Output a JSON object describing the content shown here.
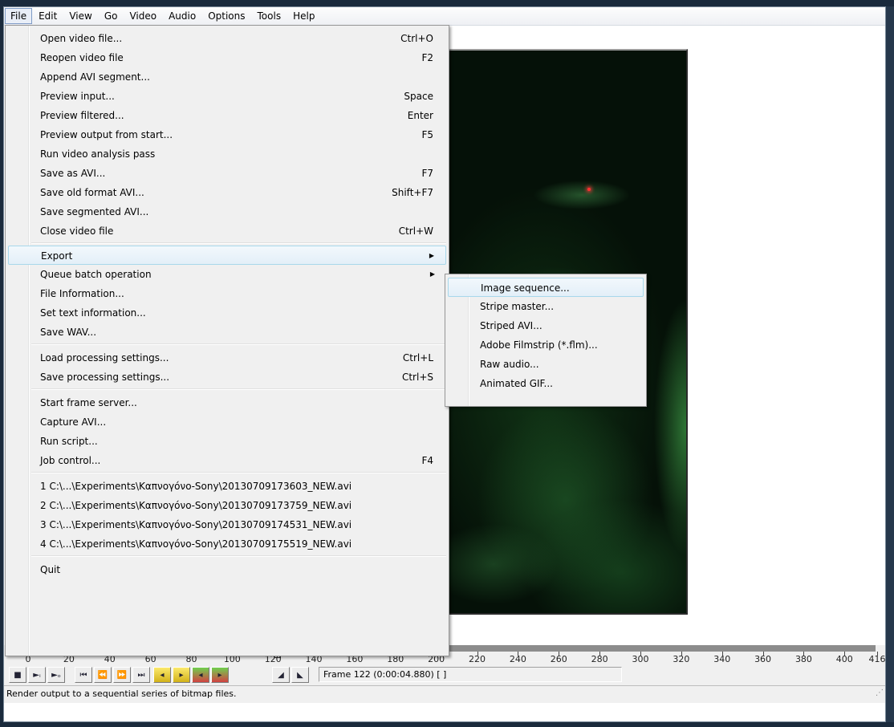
{
  "menubar": [
    "File",
    "Edit",
    "View",
    "Go",
    "Video",
    "Audio",
    "Options",
    "Tools",
    "Help"
  ],
  "file_menu": [
    {
      "label": "Open video file...",
      "shortcut": "Ctrl+O"
    },
    {
      "label": "Reopen video file",
      "shortcut": "F2"
    },
    {
      "label": "Append AVI segment...",
      "shortcut": ""
    },
    {
      "label": "Preview input...",
      "shortcut": "Space"
    },
    {
      "label": "Preview filtered...",
      "shortcut": "Enter"
    },
    {
      "label": "Preview output from start...",
      "shortcut": "F5"
    },
    {
      "label": "Run video analysis pass",
      "shortcut": ""
    },
    {
      "label": "Save as AVI...",
      "shortcut": "F7"
    },
    {
      "label": "Save old format AVI...",
      "shortcut": "Shift+F7"
    },
    {
      "label": "Save segmented AVI...",
      "shortcut": ""
    },
    {
      "label": "Close video file",
      "shortcut": "Ctrl+W"
    },
    {
      "label": "Export",
      "shortcut": ""
    },
    {
      "label": "Queue batch operation",
      "shortcut": ""
    },
    {
      "label": "File Information...",
      "shortcut": ""
    },
    {
      "label": "Set text information...",
      "shortcut": ""
    },
    {
      "label": "Save WAV...",
      "shortcut": ""
    },
    {
      "label": "Load processing settings...",
      "shortcut": "Ctrl+L"
    },
    {
      "label": "Save processing settings...",
      "shortcut": "Ctrl+S"
    },
    {
      "label": "Start frame server...",
      "shortcut": ""
    },
    {
      "label": "Capture AVI...",
      "shortcut": ""
    },
    {
      "label": "Run script...",
      "shortcut": ""
    },
    {
      "label": "Job control...",
      "shortcut": "F4"
    },
    {
      "label": "1 C:\\...\\Experiments\\Καπνογόνο-Sony\\20130709173603_NEW.avi",
      "shortcut": ""
    },
    {
      "label": "2 C:\\...\\Experiments\\Καπνογόνο-Sony\\20130709173759_NEW.avi",
      "shortcut": ""
    },
    {
      "label": "3 C:\\...\\Experiments\\Καπνογόνο-Sony\\20130709174531_NEW.avi",
      "shortcut": ""
    },
    {
      "label": "4 C:\\...\\Experiments\\Καπνογόνο-Sony\\20130709175519_NEW.avi",
      "shortcut": ""
    },
    {
      "label": "Quit",
      "shortcut": ""
    }
  ],
  "export_submenu": [
    "Image sequence...",
    "Stripe master...",
    "Striped AVI...",
    "Adobe Filmstrip (*.flm)...",
    "Raw audio...",
    "Animated GIF..."
  ],
  "timeline": {
    "labels": [
      "0",
      "20",
      "40",
      "60",
      "80",
      "100",
      "120",
      "140",
      "160",
      "180",
      "200",
      "220",
      "240",
      "260",
      "280",
      "300",
      "320",
      "340",
      "360",
      "380",
      "400",
      "416"
    ],
    "max": 416,
    "current_frame": 122
  },
  "frame_info": "Frame 122 (0:00:04.880) [ ]",
  "status_text": "Render output to a sequential series of bitmap files."
}
